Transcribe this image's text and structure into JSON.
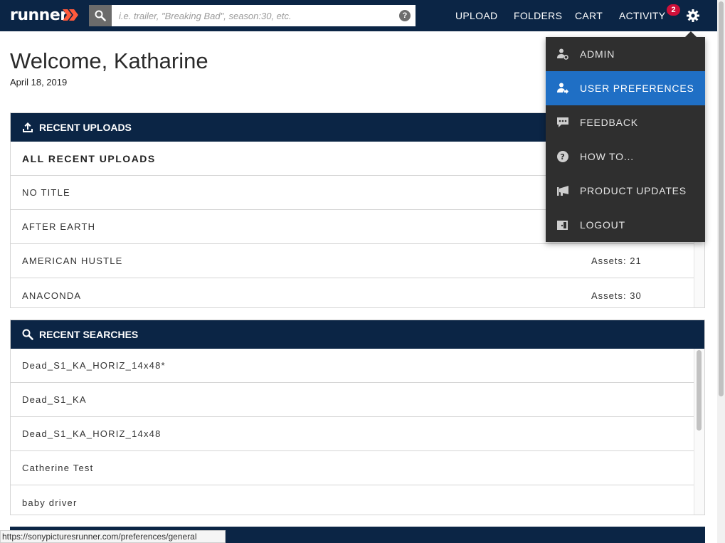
{
  "brand": {
    "logo_text": "runner"
  },
  "search": {
    "placeholder": "i.e. trailer, \"Breaking Bad\", season:30, etc."
  },
  "nav": {
    "upload": "UPLOAD",
    "folders": "FOLDERS",
    "cart": "CART",
    "activity": "ACTIVITY",
    "activity_count": "2"
  },
  "welcome": {
    "title": "Welcome, Katharine",
    "date": "April 18, 2019"
  },
  "recent_uploads": {
    "title": "RECENT UPLOADS",
    "header": "ALL RECENT UPLOADS",
    "items": [
      {
        "title": "NO TITLE",
        "assets": ""
      },
      {
        "title": "AFTER EARTH",
        "assets": ""
      },
      {
        "title": "AMERICAN HUSTLE",
        "assets": "Assets: 21"
      },
      {
        "title": "ANACONDA",
        "assets": "Assets: 30"
      }
    ]
  },
  "recent_searches": {
    "title": "RECENT SEARCHES",
    "items": [
      "Dead_S1_KA_HORIZ_14x48*",
      "Dead_S1_KA",
      "Dead_S1_KA_HORIZ_14x48",
      "Catherine Test",
      "baby driver"
    ]
  },
  "settings_menu": {
    "items": [
      {
        "label": "ADMIN",
        "icon": "admin-icon"
      },
      {
        "label": "USER PREFERENCES",
        "icon": "user-preferences-icon",
        "active": true
      },
      {
        "label": "FEEDBACK",
        "icon": "feedback-icon"
      },
      {
        "label": "HOW TO...",
        "icon": "help-icon"
      },
      {
        "label": "PRODUCT UPDATES",
        "icon": "megaphone-icon"
      },
      {
        "label": "LOGOUT",
        "icon": "logout-icon"
      }
    ]
  },
  "status_bar": {
    "url": "https://sonypicturesrunner.com/preferences/general"
  },
  "colors": {
    "navy": "#0b2545",
    "accent": "#1f6fc5",
    "badge": "#d0103a",
    "menu_bg": "#2f2f2f"
  }
}
